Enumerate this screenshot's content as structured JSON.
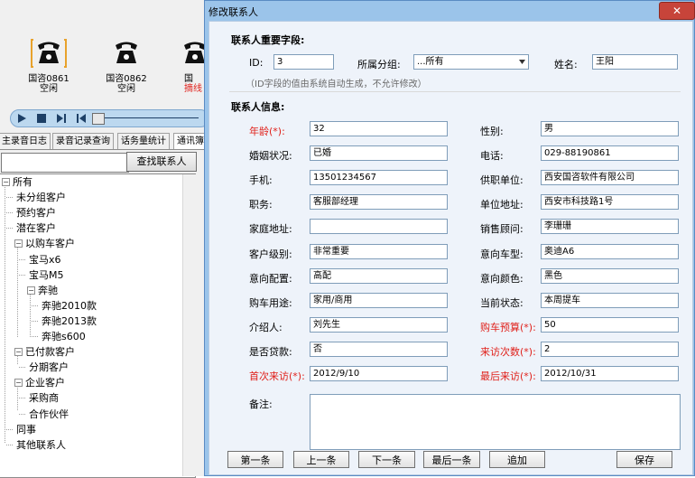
{
  "background_app": {
    "phones": [
      {
        "name": "国咨0861",
        "status": "空闲",
        "selected": true
      },
      {
        "name": "国咨0862",
        "status": "空闲",
        "selected": false
      },
      {
        "name": "国",
        "status": "摘线",
        "selected": false
      }
    ],
    "tabs": [
      "主录音日志",
      "录音记录查询",
      "话务量统计",
      "通讯簿"
    ],
    "search_button": "查找联系人",
    "search_value": "",
    "tree": [
      {
        "label": "所有",
        "level": 0,
        "expander": "⊟"
      },
      {
        "label": "未分组客户",
        "level": 1,
        "expander": ""
      },
      {
        "label": "预约客户",
        "level": 1,
        "expander": ""
      },
      {
        "label": "潜在客户",
        "level": 1,
        "expander": ""
      },
      {
        "label": "以购车客户",
        "level": 1,
        "expander": "⊟"
      },
      {
        "label": "宝马x6",
        "level": 2,
        "expander": ""
      },
      {
        "label": "宝马M5",
        "level": 2,
        "expander": ""
      },
      {
        "label": "奔驰",
        "level": 2,
        "expander": "⊟"
      },
      {
        "label": "奔驰2010款",
        "level": 3,
        "expander": ""
      },
      {
        "label": "奔驰2013款",
        "level": 3,
        "expander": ""
      },
      {
        "label": "奔驰s600",
        "level": 3,
        "expander": ""
      },
      {
        "label": "已付款客户",
        "level": 1,
        "expander": "⊟"
      },
      {
        "label": "分期客户",
        "level": 2,
        "expander": ""
      },
      {
        "label": "企业客户",
        "level": 1,
        "expander": "⊟"
      },
      {
        "label": "采购商",
        "level": 2,
        "expander": ""
      },
      {
        "label": "合作伙伴",
        "level": 2,
        "expander": ""
      },
      {
        "label": "同事",
        "level": 1,
        "expander": ""
      },
      {
        "label": "其他联系人",
        "level": 1,
        "expander": ""
      }
    ]
  },
  "dialog": {
    "title": "修改联系人",
    "close_glyph": "✕",
    "important_section": "联系人重要字段:",
    "id_label": "ID:",
    "id_value": "3",
    "group_label": "所属分组:",
    "group_value": "...所有",
    "name_label": "姓名:",
    "name_value": "王阳",
    "hint": "（ID字段的值由系统自动生成，不允许修改）",
    "info_section": "联系人信息:",
    "left_fields": [
      {
        "label": "年龄(*):",
        "value": "32",
        "required": true
      },
      {
        "label": "婚姻状况:",
        "value": "已婚",
        "required": false
      },
      {
        "label": "手机:",
        "value": "13501234567",
        "required": false
      },
      {
        "label": "职务:",
        "value": "客服部经理",
        "required": false
      },
      {
        "label": "家庭地址:",
        "value": "",
        "required": false
      },
      {
        "label": "客户级别:",
        "value": "非常重要",
        "required": false
      },
      {
        "label": "意向配置:",
        "value": "高配",
        "required": false
      },
      {
        "label": "购车用途:",
        "value": "家用/商用",
        "required": false
      },
      {
        "label": "介绍人:",
        "value": "刘先生",
        "required": false
      },
      {
        "label": "是否贷款:",
        "value": "否",
        "required": false
      },
      {
        "label": "首次来访(*):",
        "value": "2012/9/10",
        "required": true
      }
    ],
    "right_fields": [
      {
        "label": "性别:",
        "value": "男",
        "required": false
      },
      {
        "label": "电话:",
        "value": "029-88190861",
        "required": false
      },
      {
        "label": "供职单位:",
        "value": "西安国咨软件有限公司",
        "required": false
      },
      {
        "label": "单位地址:",
        "value": "西安市科技路1号",
        "required": false
      },
      {
        "label": "销售顾问:",
        "value": "李珊珊",
        "required": false
      },
      {
        "label": "意向车型:",
        "value": "奥迪A6",
        "required": false
      },
      {
        "label": "意向颜色:",
        "value": "黑色",
        "required": false
      },
      {
        "label": "当前状态:",
        "value": "本周提车",
        "required": false
      },
      {
        "label": "购车预算(*):",
        "value": "50",
        "required": true
      },
      {
        "label": "来访次数(*):",
        "value": "2",
        "required": true
      },
      {
        "label": "最后来访(*):",
        "value": "2012/10/31",
        "required": true
      }
    ],
    "notes_label": "备注:",
    "notes_value": "",
    "buttons": {
      "first": "第一条",
      "prev": "上一条",
      "next": "下一条",
      "last": "最后一条",
      "add": "追加",
      "save": "保存"
    }
  },
  "colors": {
    "required_label": "#e0201a",
    "dialog_frame": "#9bc4ea",
    "close_button": "#c7443a",
    "selected_phone_bracket": "#e8a22c"
  }
}
